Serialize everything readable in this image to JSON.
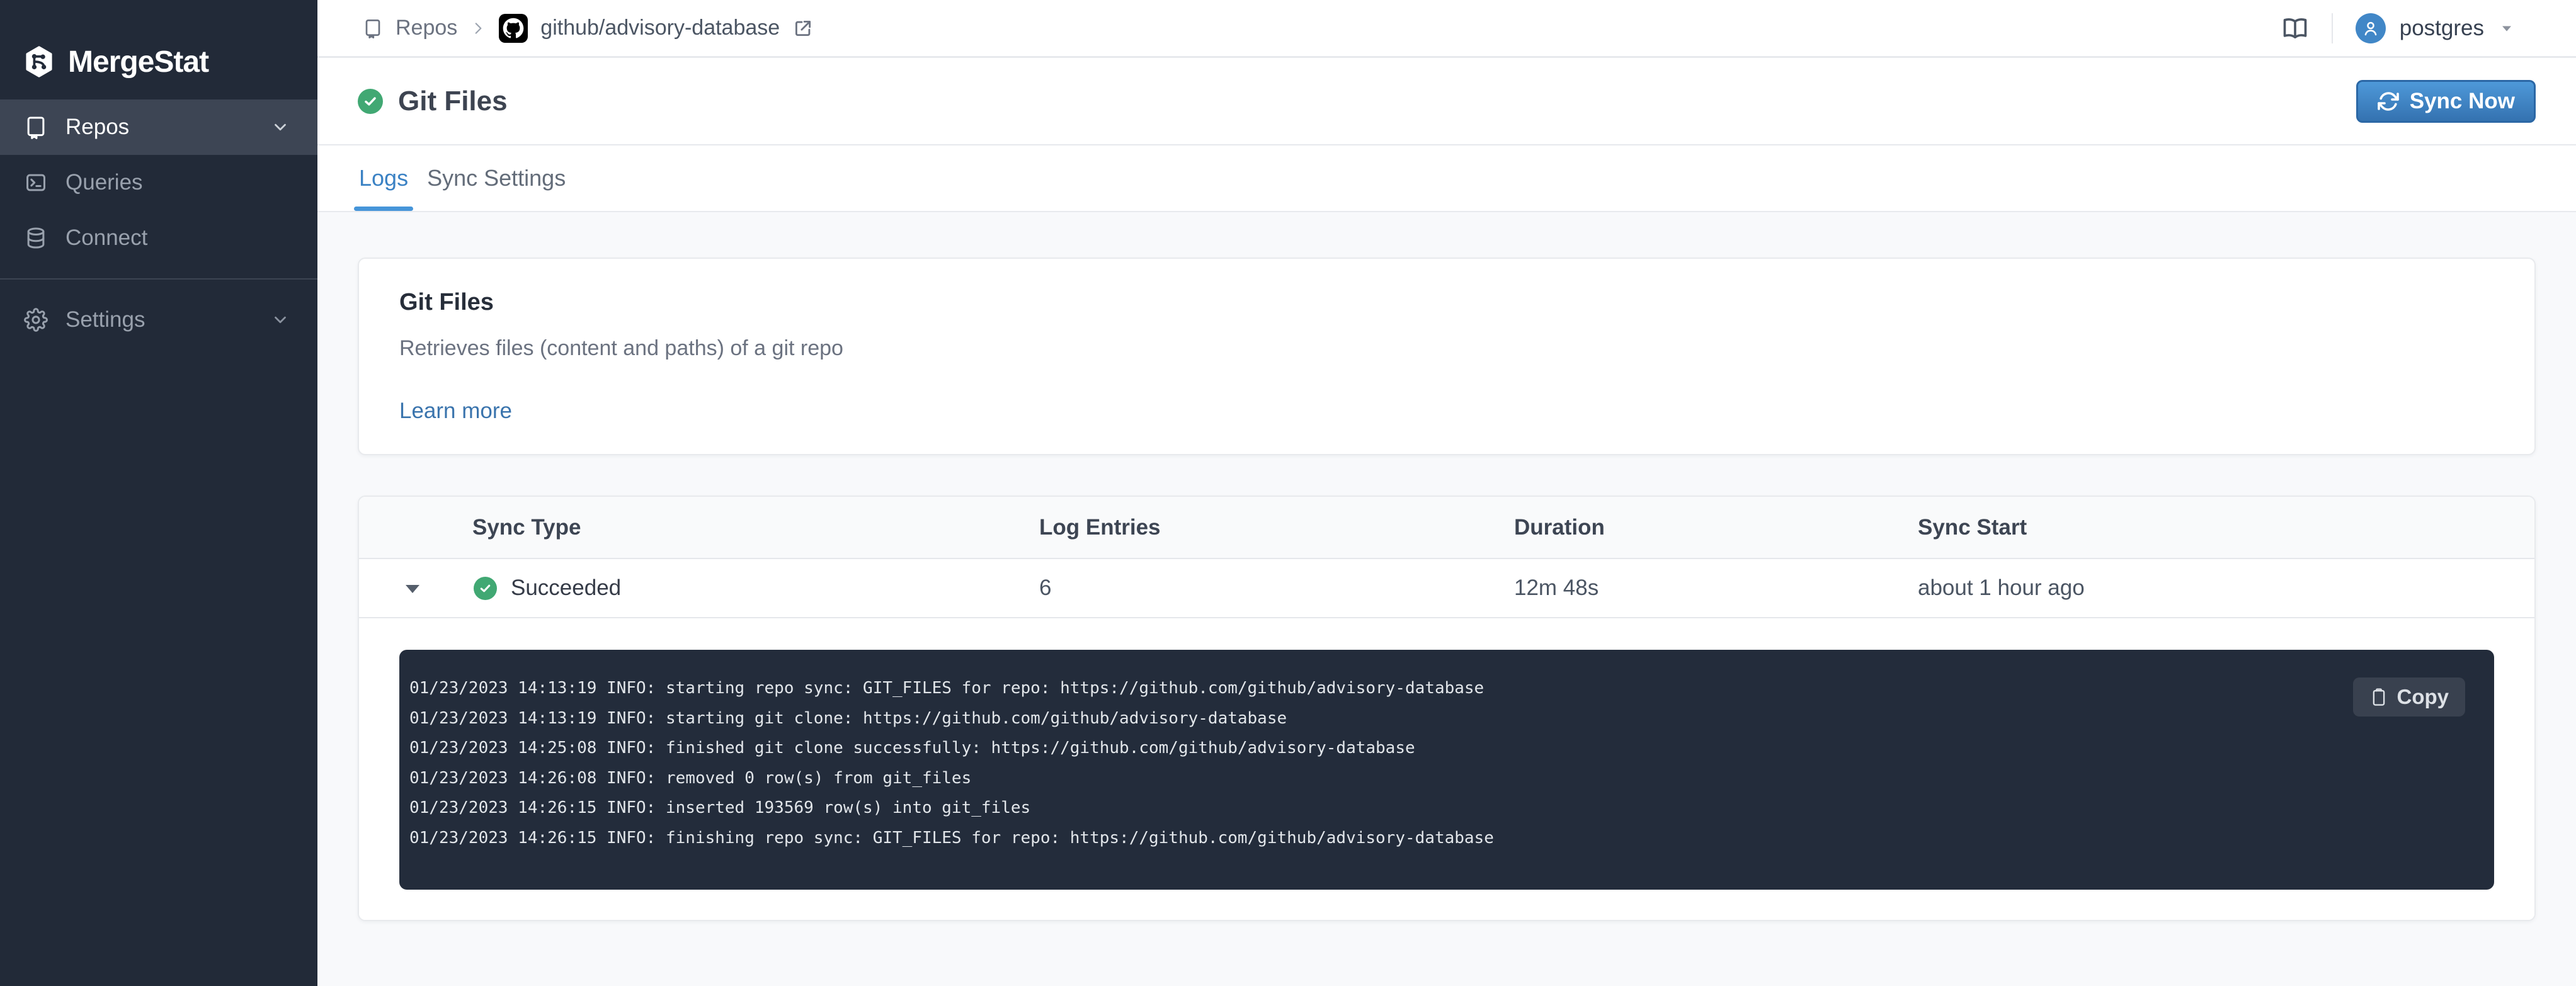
{
  "sidebar": {
    "logo_text": "MergeStat",
    "items": [
      {
        "label": "Repos",
        "active": true
      },
      {
        "label": "Queries",
        "active": false
      },
      {
        "label": "Connect",
        "active": false
      },
      {
        "label": "Settings",
        "active": false
      }
    ]
  },
  "topbar": {
    "breadcrumb": {
      "root": "Repos",
      "repo": "github/advisory-database"
    },
    "user": {
      "name": "postgres"
    }
  },
  "page": {
    "title": "Git Files",
    "sync_now_label": "Sync Now",
    "tabs": [
      {
        "label": "Logs",
        "active": true
      },
      {
        "label": "Sync Settings",
        "active": false
      }
    ]
  },
  "info_card": {
    "title": "Git Files",
    "description": "Retrieves files (content and paths) of a git repo",
    "link_label": "Learn more"
  },
  "sync_table": {
    "columns": [
      "Sync Type",
      "Log Entries",
      "Duration",
      "Sync Start"
    ],
    "rows": [
      {
        "status": "Succeeded",
        "log_entries": "6",
        "duration": "12m 48s",
        "sync_start": "about 1 hour ago"
      }
    ]
  },
  "log_panel": {
    "copy_label": "Copy",
    "lines": [
      "01/23/2023 14:13:19 INFO: starting repo sync: GIT_FILES for repo: https://github.com/github/advisory-database",
      "01/23/2023 14:13:19 INFO: starting git clone: https://github.com/github/advisory-database",
      "01/23/2023 14:25:08 INFO: finished git clone successfully: https://github.com/github/advisory-database",
      "01/23/2023 14:26:08 INFO: removed 0 row(s) from git_files",
      "01/23/2023 14:26:15 INFO: inserted 193569 row(s) into git_files",
      "01/23/2023 14:26:15 INFO: finishing repo sync: GIT_FILES for repo: https://github.com/github/advisory-database"
    ]
  },
  "icons": {
    "logo": "hexagon-branch",
    "repos": "book",
    "queries": "terminal",
    "connect": "database",
    "settings": "gear",
    "docs": "open-book",
    "status_ok": "check-circle",
    "sync": "refresh-arrows",
    "copy": "clipboard",
    "external": "external-link"
  },
  "colors": {
    "accent_blue": "#3b82c4",
    "tab_underline": "#4695d9",
    "success_green": "#41a873",
    "sidebar_bg": "#222a38",
    "sidebar_active_bg": "#3d4554",
    "log_bg": "#232c3b",
    "page_bg": "#f8f9fb",
    "avatar_blue": "#4187c7",
    "button_top": "#4e99d9",
    "button_bottom": "#3472b0",
    "button_border": "#2b67a5"
  }
}
